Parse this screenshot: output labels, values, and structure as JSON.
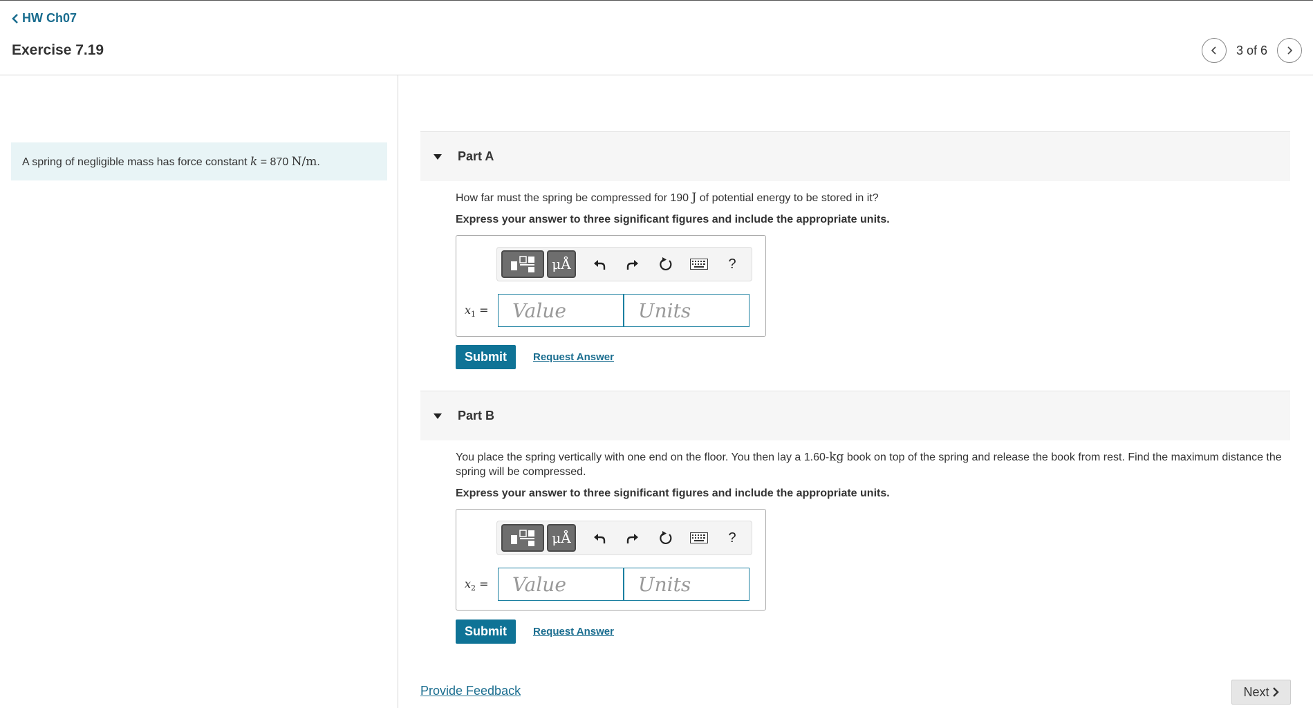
{
  "nav": {
    "back_label": "HW Ch07",
    "exercise_title": "Exercise 7.19",
    "pager_text": "3 of 6"
  },
  "problem": {
    "prefix": "A spring of negligible mass has force constant ",
    "var": "k",
    "equals": " = 870 ",
    "unit": "N/m",
    "suffix": "."
  },
  "parts": [
    {
      "label": "Part A",
      "question_pre": "How far must the spring be compressed for 190 ",
      "question_unit": "J",
      "question_post": " of potential energy to be stored in it?",
      "instruction": "Express your answer to three significant figures and include the appropriate units.",
      "var": "x",
      "var_sub": "1",
      "value_placeholder": "Value",
      "units_placeholder": "Units",
      "submit_label": "Submit",
      "request_label": "Request Answer"
    },
    {
      "label": "Part B",
      "question_pre": "You place the spring vertically with one end on the floor. You then lay a 1.60-",
      "question_unit": "kg",
      "question_post": " book on top of the spring and release the book from rest. Find the maximum distance the spring will be compressed.",
      "instruction": "Express your answer to three significant figures and include the appropriate units.",
      "var": "x",
      "var_sub": "2",
      "value_placeholder": "Value",
      "units_placeholder": "Units",
      "submit_label": "Submit",
      "request_label": "Request Answer"
    }
  ],
  "toolbar": {
    "mu_label": "μÅ",
    "help_label": "?",
    "icons": [
      "templates-icon",
      "units-icon",
      "undo-icon",
      "redo-icon",
      "reset-icon",
      "keyboard-icon",
      "help-icon"
    ]
  },
  "footer": {
    "feedback_label": "Provide Feedback",
    "next_label": "Next"
  },
  "colors": {
    "link": "#1a6d8f",
    "submit": "#0f7396",
    "problem_bg": "#e8f4f6",
    "field_border": "#1a7fa0"
  }
}
